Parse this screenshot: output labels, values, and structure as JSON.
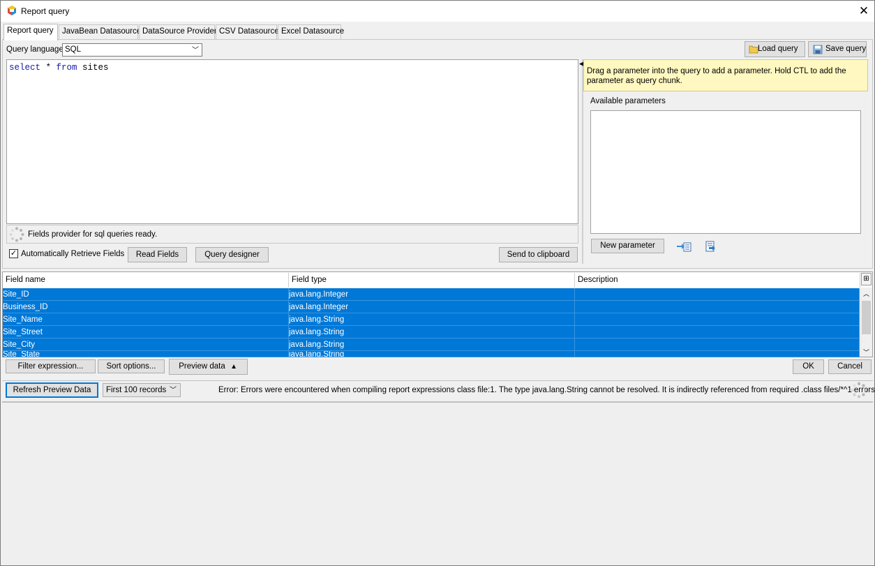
{
  "window": {
    "title": "Report query",
    "close_glyph": "✕"
  },
  "tabs": [
    {
      "label": "Report query",
      "active": true
    },
    {
      "label": "JavaBean Datasource",
      "active": false
    },
    {
      "label": "DataSource Provider",
      "active": false
    },
    {
      "label": "CSV Datasource",
      "active": false
    },
    {
      "label": "Excel Datasource",
      "active": false
    }
  ],
  "query": {
    "language_label": "Query language",
    "language_value": "SQL",
    "text_kw1": "select",
    "text_mid": " * ",
    "text_kw2": "from",
    "text_rest": " sites",
    "status": "Fields provider for sql queries ready.",
    "auto_retrieve_label": "Automatically Retrieve Fields",
    "auto_retrieve_checked": true,
    "read_fields_button": "Read Fields",
    "query_designer_button": "Query designer",
    "send_clipboard_button": "Send to clipboard"
  },
  "toolbar": {
    "load_query": "Load query",
    "save_query": "Save query"
  },
  "parameters": {
    "tip": "Drag a parameter into the query to add a parameter. Hold CTL to add the parameter as query chunk.",
    "available_label": "Available parameters",
    "new_parameter_button": "New parameter"
  },
  "fields_table": {
    "columns": [
      "Field name",
      "Field type",
      "Description"
    ],
    "rows": [
      [
        "Site_ID",
        "java.lang.Integer",
        ""
      ],
      [
        "Business_ID",
        "java.lang.Integer",
        ""
      ],
      [
        "Site_Name",
        "java.lang.String",
        ""
      ],
      [
        "Site_Street",
        "java.lang.String",
        ""
      ],
      [
        "Site_City",
        "java.lang.String",
        ""
      ],
      [
        "Site_State",
        "java.lang.String",
        ""
      ]
    ]
  },
  "actions": {
    "filter_expression": "Filter expression...",
    "sort_options": "Sort options...",
    "preview_data": "Preview data",
    "ok": "OK",
    "cancel": "Cancel"
  },
  "preview": {
    "refresh_button": "Refresh Preview Data",
    "records_value": "First 100 records",
    "error": "Error: Errors were encountered when compiling report expressions class file:1. The type java.lang.String cannot be resolved. It is indirectly referenced from required .class files/*^1 errors"
  },
  "colors": {
    "selection": "#0078d7",
    "tip_background": "#fff8c0",
    "keyword": "#1a1aa6"
  }
}
